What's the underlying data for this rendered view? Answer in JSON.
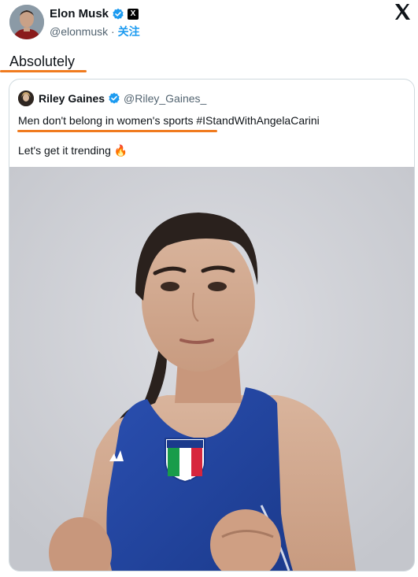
{
  "author": {
    "name": "Elon Musk",
    "handle": "@elonmusk",
    "separator": "·",
    "follow_label": "关注",
    "verified_icon": "verified-badge-icon",
    "platform_badge": "X"
  },
  "close_glyph": "𝕏",
  "tweet": {
    "text": "Absolutely"
  },
  "quoted": {
    "name": "Riley Gaines",
    "handle": "@Riley_Gaines_",
    "line1": "Men don't belong in women's sports #IStandWithAngelaCarini",
    "line2": "Let's get it trending",
    "emoji": "🔥"
  },
  "colors": {
    "accent": "#1d9bf0",
    "underline": "#f07b1f",
    "border": "#cfd9de"
  }
}
